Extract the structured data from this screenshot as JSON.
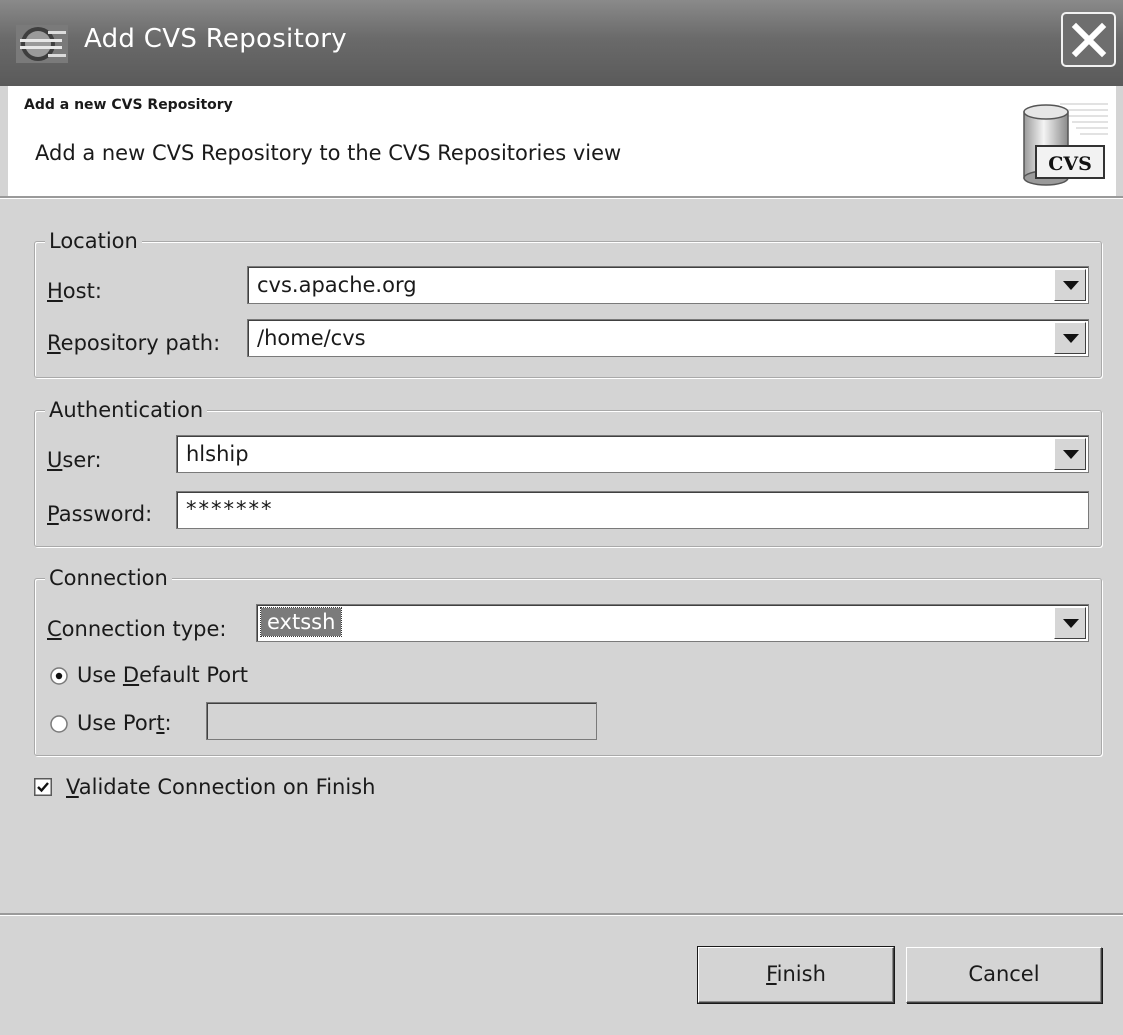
{
  "window": {
    "title": "Add CVS Repository",
    "close_icon": "close-icon"
  },
  "banner": {
    "title": "Add a new CVS Repository",
    "description": "Add a new CVS Repository to the CVS Repositories view",
    "icon_label": "CVS"
  },
  "location": {
    "legend": "Location",
    "host_label_mnemonic": "H",
    "host_label_rest": "ost:",
    "host_value": "cvs.apache.org",
    "path_label_mnemonic": "R",
    "path_label_rest": "epository path:",
    "path_value": "/home/cvs"
  },
  "authentication": {
    "legend": "Authentication",
    "user_label_mnemonic": "U",
    "user_label_rest": "ser:",
    "user_value": "hlship",
    "password_label_mnemonic": "P",
    "password_label_rest": "assword:",
    "password_value": "*******"
  },
  "connection": {
    "legend": "Connection",
    "type_label_mnemonic": "C",
    "type_label_rest": "onnection type:",
    "type_value": "extssh",
    "default_port_label_pre": "Use ",
    "default_port_label_mnemonic": "D",
    "default_port_label_post": "efault Port",
    "default_port_selected": true,
    "use_port_label_pre": "Use Por",
    "use_port_label_mnemonic": "t",
    "use_port_label_post": ":",
    "use_port_value": ""
  },
  "validate": {
    "label_mnemonic": "V",
    "label_rest": "alidate Connection on Finish",
    "checked": true
  },
  "buttons": {
    "finish_mnemonic": "F",
    "finish_rest": "inish",
    "cancel": "Cancel"
  },
  "colors": {
    "titlebar": "#6a6a6a",
    "dialog_bg": "#d4d4d4",
    "selection": "#7b7b7b"
  }
}
